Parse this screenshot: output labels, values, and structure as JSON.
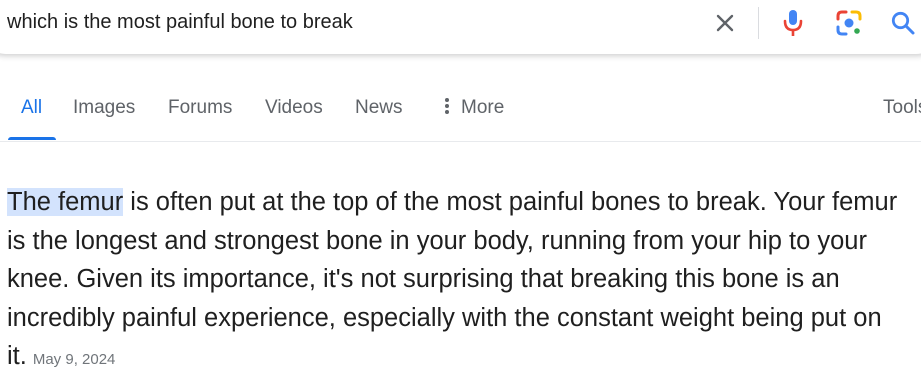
{
  "search": {
    "query": "which is the most painful bone to break",
    "icons": [
      "close-icon",
      "microphone-icon",
      "google-lens-icon",
      "search-icon"
    ]
  },
  "tabs": [
    {
      "label": "All",
      "active": true
    },
    {
      "label": "Images",
      "active": false
    },
    {
      "label": "Forums",
      "active": false
    },
    {
      "label": "Videos",
      "active": false
    },
    {
      "label": "News",
      "active": false
    },
    {
      "label": "More",
      "active": false
    }
  ],
  "tools_label": "Tools",
  "answer": {
    "highlight": "The femur",
    "body": " is often put at the top of the most painful bones to break. Your femur is the longest and strongest bone in your body, running from your hip to your knee. Given its importance, it's not surprising that breaking this bone is an incredibly painful experience, especially with the constant weight being put on it.",
    "date": "May 9, 2024"
  },
  "colors": {
    "accent": "#1a73e8",
    "highlight": "#d3e3fd",
    "muted_text": "#5f6368",
    "mic_blue": "#4285f4",
    "mic_red": "#ea4335",
    "lens_yellow": "#fbbc04",
    "lens_green": "#34a853"
  }
}
